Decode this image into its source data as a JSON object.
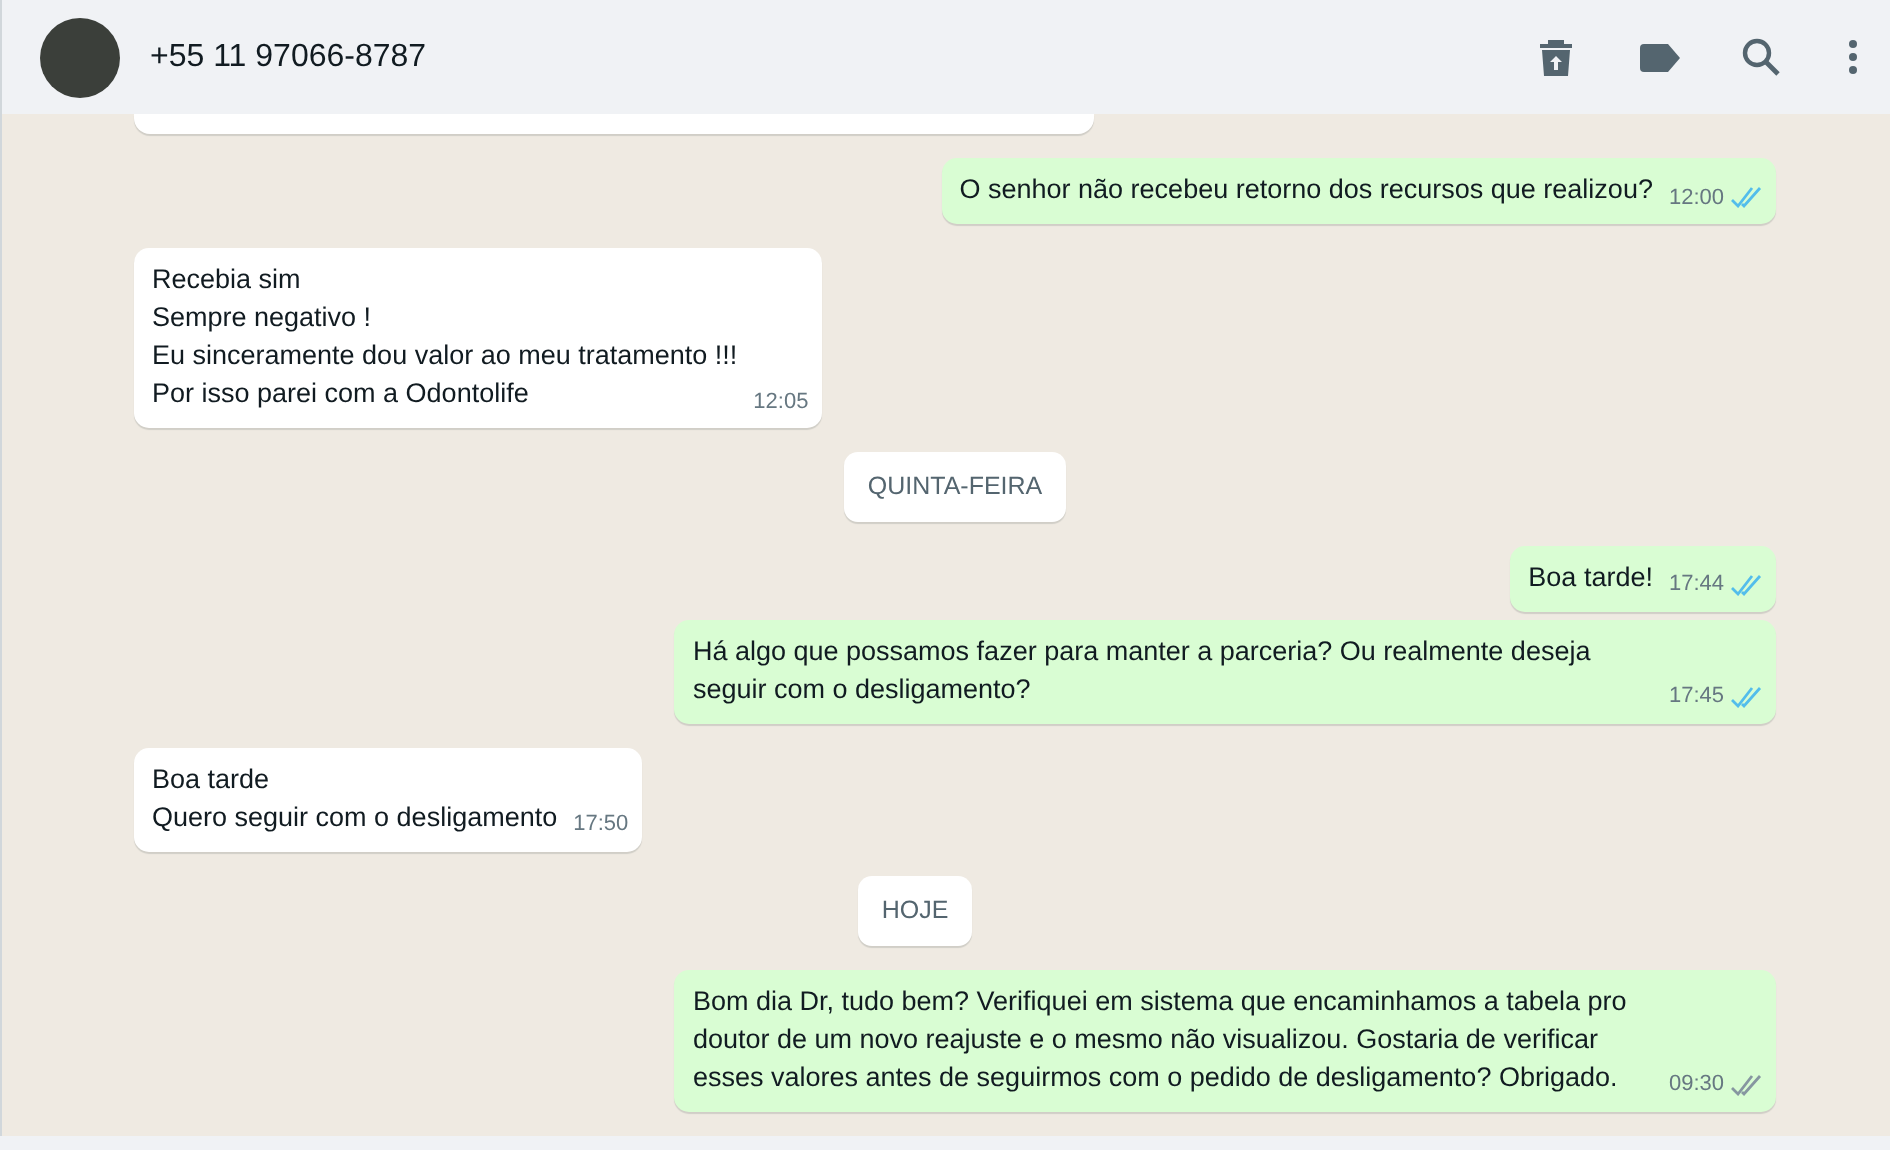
{
  "header": {
    "contact": "+55 11 97066-8787"
  },
  "messages": [
    {
      "kind": "stub",
      "outgoing": false
    },
    {
      "kind": "message",
      "outgoing": true,
      "text": "O senhor não recebeu retorno dos recursos que realizou?",
      "time": "12:00",
      "read": true
    },
    {
      "kind": "message",
      "outgoing": false,
      "text": "Recebia sim\nSempre negativo !\nEu sinceramente dou valor ao meu tratamento !!!\nPor isso parei com a Odontolife",
      "time": "12:05"
    },
    {
      "kind": "date",
      "text": "QUINTA-FEIRA"
    },
    {
      "kind": "message",
      "outgoing": true,
      "text": "Boa tarde!",
      "time": "17:44",
      "read": true
    },
    {
      "kind": "message",
      "outgoing": true,
      "text": "Há algo que possamos fazer para manter a parceria? Ou realmente deseja seguir com o desligamento?",
      "time": "17:45",
      "read": true
    },
    {
      "kind": "message",
      "outgoing": false,
      "text": "Boa tarde\nQuero seguir com o desligamento",
      "time": "17:50"
    },
    {
      "kind": "date",
      "text": "HOJE"
    },
    {
      "kind": "message",
      "outgoing": true,
      "text": "Bom dia Dr, tudo bem? Verifiquei em sistema que encaminhamos a tabela pro doutor de um novo reajuste e o mesmo não visualizou. Gostaria de verificar esses valores antes de seguirmos com o pedido de desligamento? Obrigado.",
      "time": "09:30",
      "read": false
    }
  ]
}
